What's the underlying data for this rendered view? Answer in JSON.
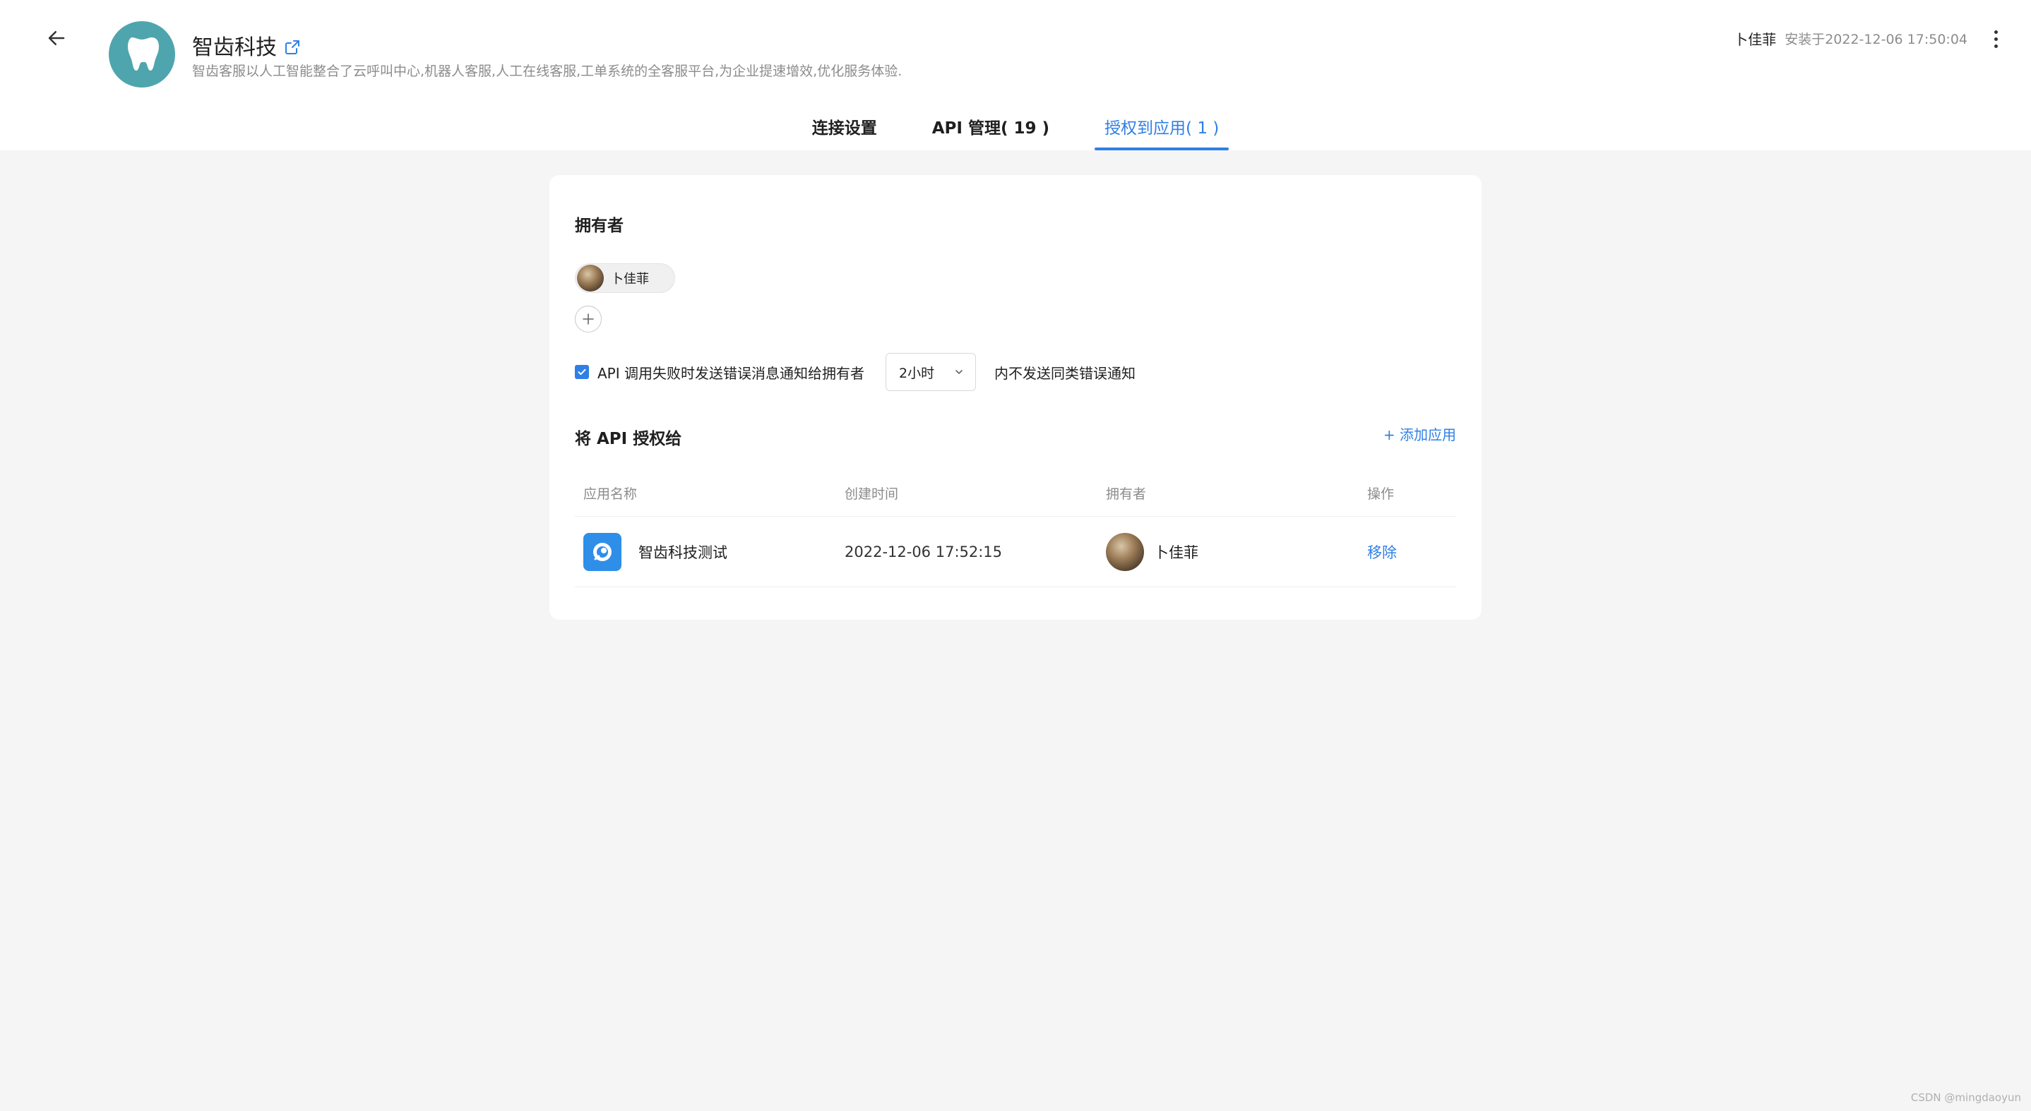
{
  "header": {
    "app_name": "智齿科技",
    "app_description": "智齿客服以人工智能整合了云呼叫中心,机器人客服,人工在线客服,工单系统的全客服平台,为企业提速增效,优化服务体验.",
    "installer": "卜佳菲",
    "installed_text": "安装于2022-12-06 17:50:04",
    "logo_color": "#4fa5ad"
  },
  "tabs": [
    {
      "label": "连接设置",
      "active": false
    },
    {
      "label": "API 管理( 19 )",
      "active": false
    },
    {
      "label": "授权到应用( 1 )",
      "active": true
    }
  ],
  "owners_section": {
    "title": "拥有者",
    "owners": [
      {
        "name": "卜佳菲"
      }
    ]
  },
  "notification": {
    "checked": true,
    "label": "API 调用失败时发送错误消息通知给拥有者",
    "interval_value": "2小时",
    "suffix": "内不发送同类错误通知"
  },
  "authorize_section": {
    "title": "将 API 授权给",
    "add_app_label": "+ 添加应用",
    "columns": [
      "应用名称",
      "创建时间",
      "拥有者",
      "操作"
    ],
    "rows": [
      {
        "app_name": "智齿科技测试",
        "created": "2022-12-06 17:52:15",
        "owner": "卜佳菲",
        "action": "移除"
      }
    ]
  },
  "watermark": "CSDN @mingdaoyun",
  "accent_color": "#2f7fe6"
}
